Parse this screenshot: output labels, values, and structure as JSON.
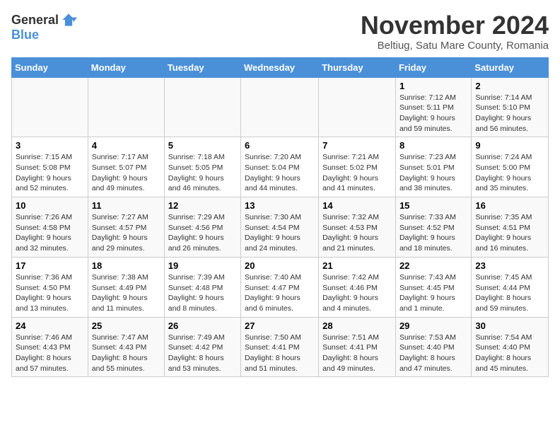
{
  "logo": {
    "text_general": "General",
    "text_blue": "Blue"
  },
  "title": "November 2024",
  "location": "Beltiug, Satu Mare County, Romania",
  "days_of_week": [
    "Sunday",
    "Monday",
    "Tuesday",
    "Wednesday",
    "Thursday",
    "Friday",
    "Saturday"
  ],
  "weeks": [
    [
      {
        "day": "",
        "content": ""
      },
      {
        "day": "",
        "content": ""
      },
      {
        "day": "",
        "content": ""
      },
      {
        "day": "",
        "content": ""
      },
      {
        "day": "",
        "content": ""
      },
      {
        "day": "1",
        "content": "Sunrise: 7:12 AM\nSunset: 5:11 PM\nDaylight: 9 hours and 59 minutes."
      },
      {
        "day": "2",
        "content": "Sunrise: 7:14 AM\nSunset: 5:10 PM\nDaylight: 9 hours and 56 minutes."
      }
    ],
    [
      {
        "day": "3",
        "content": "Sunrise: 7:15 AM\nSunset: 5:08 PM\nDaylight: 9 hours and 52 minutes."
      },
      {
        "day": "4",
        "content": "Sunrise: 7:17 AM\nSunset: 5:07 PM\nDaylight: 9 hours and 49 minutes."
      },
      {
        "day": "5",
        "content": "Sunrise: 7:18 AM\nSunset: 5:05 PM\nDaylight: 9 hours and 46 minutes."
      },
      {
        "day": "6",
        "content": "Sunrise: 7:20 AM\nSunset: 5:04 PM\nDaylight: 9 hours and 44 minutes."
      },
      {
        "day": "7",
        "content": "Sunrise: 7:21 AM\nSunset: 5:02 PM\nDaylight: 9 hours and 41 minutes."
      },
      {
        "day": "8",
        "content": "Sunrise: 7:23 AM\nSunset: 5:01 PM\nDaylight: 9 hours and 38 minutes."
      },
      {
        "day": "9",
        "content": "Sunrise: 7:24 AM\nSunset: 5:00 PM\nDaylight: 9 hours and 35 minutes."
      }
    ],
    [
      {
        "day": "10",
        "content": "Sunrise: 7:26 AM\nSunset: 4:58 PM\nDaylight: 9 hours and 32 minutes."
      },
      {
        "day": "11",
        "content": "Sunrise: 7:27 AM\nSunset: 4:57 PM\nDaylight: 9 hours and 29 minutes."
      },
      {
        "day": "12",
        "content": "Sunrise: 7:29 AM\nSunset: 4:56 PM\nDaylight: 9 hours and 26 minutes."
      },
      {
        "day": "13",
        "content": "Sunrise: 7:30 AM\nSunset: 4:54 PM\nDaylight: 9 hours and 24 minutes."
      },
      {
        "day": "14",
        "content": "Sunrise: 7:32 AM\nSunset: 4:53 PM\nDaylight: 9 hours and 21 minutes."
      },
      {
        "day": "15",
        "content": "Sunrise: 7:33 AM\nSunset: 4:52 PM\nDaylight: 9 hours and 18 minutes."
      },
      {
        "day": "16",
        "content": "Sunrise: 7:35 AM\nSunset: 4:51 PM\nDaylight: 9 hours and 16 minutes."
      }
    ],
    [
      {
        "day": "17",
        "content": "Sunrise: 7:36 AM\nSunset: 4:50 PM\nDaylight: 9 hours and 13 minutes."
      },
      {
        "day": "18",
        "content": "Sunrise: 7:38 AM\nSunset: 4:49 PM\nDaylight: 9 hours and 11 minutes."
      },
      {
        "day": "19",
        "content": "Sunrise: 7:39 AM\nSunset: 4:48 PM\nDaylight: 9 hours and 8 minutes."
      },
      {
        "day": "20",
        "content": "Sunrise: 7:40 AM\nSunset: 4:47 PM\nDaylight: 9 hours and 6 minutes."
      },
      {
        "day": "21",
        "content": "Sunrise: 7:42 AM\nSunset: 4:46 PM\nDaylight: 9 hours and 4 minutes."
      },
      {
        "day": "22",
        "content": "Sunrise: 7:43 AM\nSunset: 4:45 PM\nDaylight: 9 hours and 1 minute."
      },
      {
        "day": "23",
        "content": "Sunrise: 7:45 AM\nSunset: 4:44 PM\nDaylight: 8 hours and 59 minutes."
      }
    ],
    [
      {
        "day": "24",
        "content": "Sunrise: 7:46 AM\nSunset: 4:43 PM\nDaylight: 8 hours and 57 minutes."
      },
      {
        "day": "25",
        "content": "Sunrise: 7:47 AM\nSunset: 4:43 PM\nDaylight: 8 hours and 55 minutes."
      },
      {
        "day": "26",
        "content": "Sunrise: 7:49 AM\nSunset: 4:42 PM\nDaylight: 8 hours and 53 minutes."
      },
      {
        "day": "27",
        "content": "Sunrise: 7:50 AM\nSunset: 4:41 PM\nDaylight: 8 hours and 51 minutes."
      },
      {
        "day": "28",
        "content": "Sunrise: 7:51 AM\nSunset: 4:41 PM\nDaylight: 8 hours and 49 minutes."
      },
      {
        "day": "29",
        "content": "Sunrise: 7:53 AM\nSunset: 4:40 PM\nDaylight: 8 hours and 47 minutes."
      },
      {
        "day": "30",
        "content": "Sunrise: 7:54 AM\nSunset: 4:40 PM\nDaylight: 8 hours and 45 minutes."
      }
    ]
  ]
}
